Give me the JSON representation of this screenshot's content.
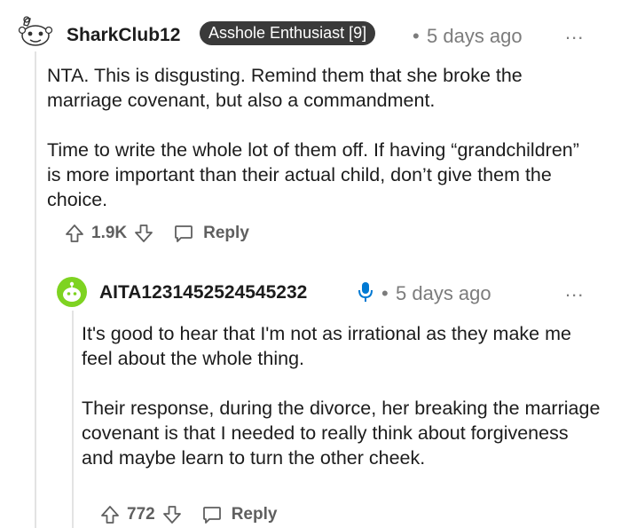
{
  "comment": {
    "username": "SharkClub12",
    "flair": "Asshole Enthusiast [9]",
    "separator": "•",
    "timestamp": "5 days ago",
    "more_label": "...",
    "paragraphs": [
      "NTA. This is disgusting. Remind them that she broke the marriage covenant, but also a commandment.",
      "Time to write the whole lot of them off. If having “grandchildren” is more important than their actual child, don’t give them the choice."
    ],
    "score": "1.9K",
    "reply_label": "Reply"
  },
  "reply": {
    "username": "AITA1231452524545232",
    "op_icon": "microphone-icon",
    "separator": "•",
    "timestamp": "5 days ago",
    "more_label": "...",
    "paragraphs": [
      "It's good to hear that I'm not as irrational as they make me feel about the whole thing.",
      "Their response, during the divorce, her breaking the marriage covenant is that I needed to really think about forgiveness and maybe learn to turn the other cheek."
    ],
    "score": "772",
    "reply_label": "Reply"
  },
  "colors": {
    "text": "#1c1c1c",
    "meta": "#7c7c7c",
    "flair_bg": "#3a3a3a",
    "op_icon": "#0079d3",
    "reply_avatar": "#7ed321"
  }
}
